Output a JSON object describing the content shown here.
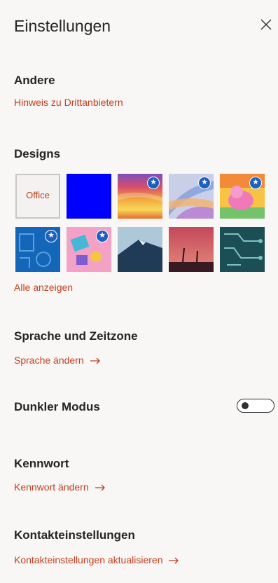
{
  "header": {
    "title": "Einstellungen"
  },
  "andere": {
    "heading": "Andere",
    "link": "Hinweis zu Drittanbietern"
  },
  "designs": {
    "heading": "Designs",
    "office_label": "Office",
    "show_all": "Alle anzeigen",
    "star_glyph": "★"
  },
  "sprache": {
    "heading": "Sprache und Zeitzone",
    "link": "Sprache ändern"
  },
  "dunkel": {
    "heading": "Dunkler Modus",
    "toggle_on": false
  },
  "kennwort": {
    "heading": "Kennwort",
    "link": "Kennwort ändern"
  },
  "kontakt": {
    "heading": "Kontakteinstellungen",
    "link": "Kontakteinstellungen aktualisieren"
  },
  "colors": {
    "accent": "#c43e1c",
    "star": "#1d5fbf",
    "blue_theme": "#0000ff"
  }
}
